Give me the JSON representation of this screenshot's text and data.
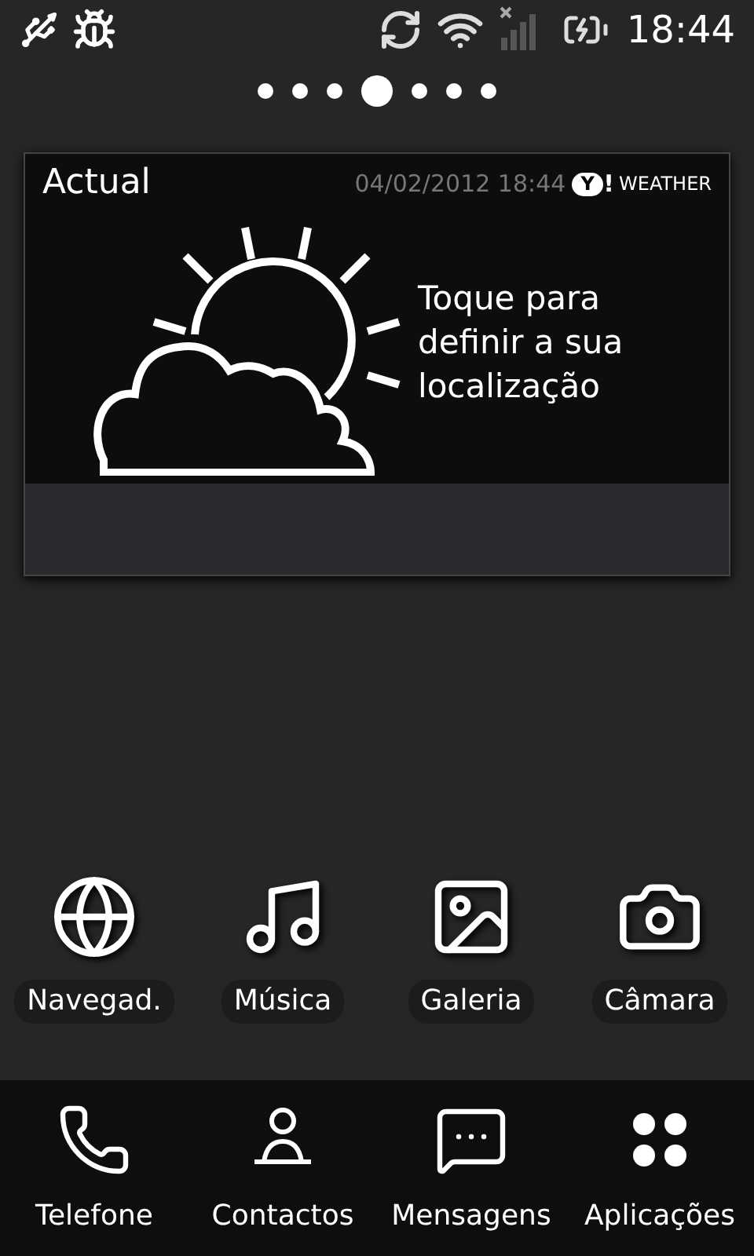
{
  "status_bar": {
    "time": "18:44"
  },
  "pages": [
    {
      "selected": false
    },
    {
      "selected": false
    },
    {
      "selected": false
    },
    {
      "selected": true
    },
    {
      "selected": false
    },
    {
      "selected": false
    },
    {
      "selected": false
    }
  ],
  "weather_widget": {
    "title": "Actual",
    "timestamp": "04/02/2012 18:44",
    "logo_mark": "Y",
    "logo_bang": "!",
    "brand": "WEATHER",
    "message": "Toque para definir a sua localização"
  },
  "shortcuts": [
    {
      "kind": "globe",
      "label": "Navegad."
    },
    {
      "kind": "music",
      "label": "Música"
    },
    {
      "kind": "gallery",
      "label": "Galeria"
    },
    {
      "kind": "camera",
      "label": "Câmara"
    }
  ],
  "dock": [
    {
      "kind": "phone",
      "label": "Telefone"
    },
    {
      "kind": "contacts",
      "label": "Contactos"
    },
    {
      "kind": "messages",
      "label": "Mensagens"
    },
    {
      "kind": "apps",
      "label": "Aplicações"
    }
  ]
}
